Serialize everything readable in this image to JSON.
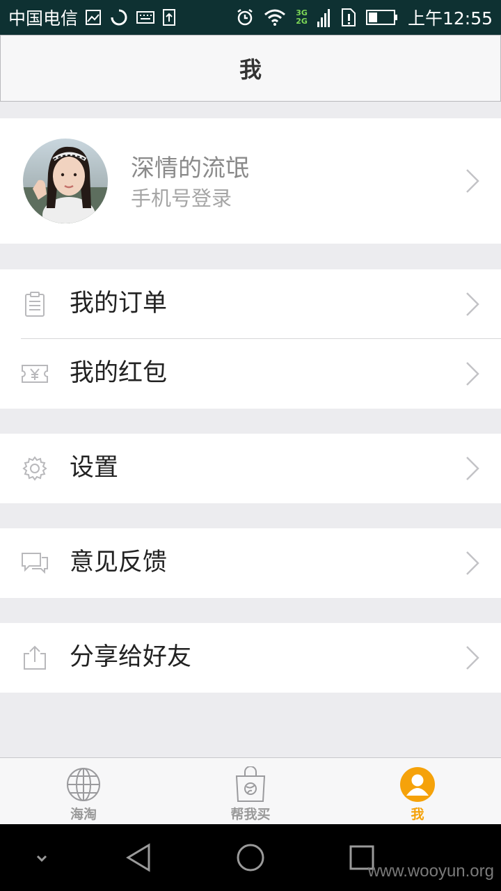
{
  "status_bar": {
    "carrier": "中国电信",
    "net_top": "3G",
    "net_bottom": "2G",
    "time": "上午12:55"
  },
  "header": {
    "title": "我"
  },
  "profile": {
    "name": "深情的流氓",
    "subtitle": "手机号登录"
  },
  "menu": {
    "orders": {
      "label": "我的订单",
      "icon": "clipboard-icon"
    },
    "red_packets": {
      "label": "我的红包",
      "icon": "ticket-yen-icon"
    },
    "settings": {
      "label": "设置",
      "icon": "gear-icon"
    },
    "feedback": {
      "label": "意见反馈",
      "icon": "chat-bubbles-icon"
    },
    "share": {
      "label": "分享给好友",
      "icon": "share-upload-icon"
    }
  },
  "tabbar": {
    "tabs": [
      {
        "label": "海淘",
        "icon": "globe-icon"
      },
      {
        "label": "帮我买",
        "icon": "shopping-bag-icon"
      },
      {
        "label": "我",
        "icon": "person-icon",
        "active": true
      }
    ]
  },
  "colors": {
    "accent": "#f5a20a",
    "statusbar": "#0e3132",
    "background": "#ececef"
  },
  "watermark": "www.wooyun.org"
}
